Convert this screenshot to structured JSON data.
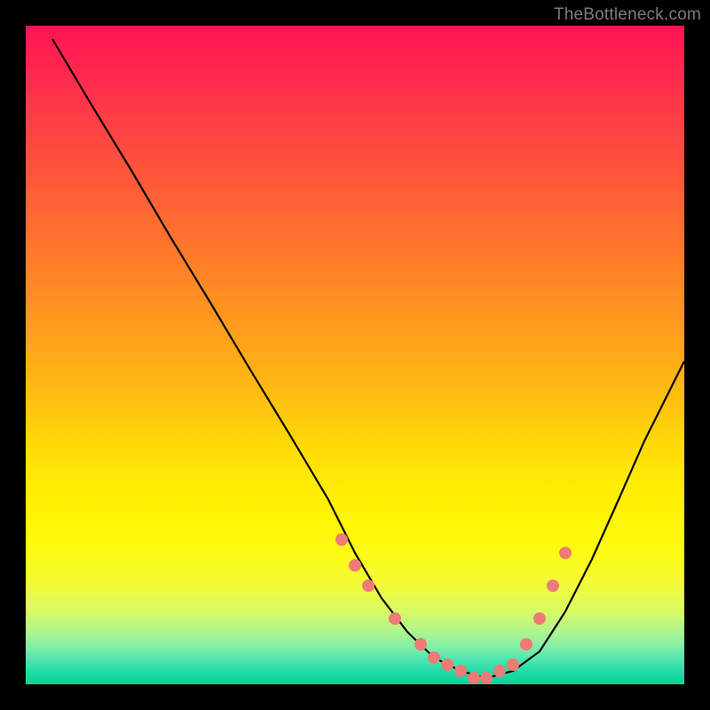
{
  "watermark": "TheBottleneck.com",
  "chart_data": {
    "type": "line",
    "title": "",
    "xlabel": "",
    "ylabel": "",
    "xlim": [
      0,
      100
    ],
    "ylim": [
      0,
      100
    ],
    "note": "Bottleneck curve with gradient background (red = high bottleneck, green = low). No axis ticks or numeric labels are visible in the image; x/y values below are pixel-space estimates on a 0–100 normalized scale.",
    "series": [
      {
        "name": "bottleneck-curve",
        "x": [
          4,
          10,
          16,
          22,
          28,
          34,
          40,
          46,
          50,
          54,
          58,
          62,
          66,
          70,
          74,
          78,
          82,
          86,
          90,
          94,
          98,
          100
        ],
        "y": [
          98,
          88,
          78,
          68,
          58,
          48,
          38,
          28,
          20,
          13,
          8,
          4,
          2,
          1,
          2,
          5,
          11,
          19,
          28,
          37,
          45,
          49
        ]
      }
    ],
    "markers": {
      "name": "highlight-dots",
      "color": "#ef7b76",
      "approximate_radius_px": 6,
      "note": "Salmon dots clustered around the valley on both branches, roughly y in [1,22].",
      "x": [
        48,
        50,
        52,
        56,
        60,
        62,
        64,
        66,
        68,
        70,
        72,
        74,
        76,
        78,
        80,
        82
      ],
      "y": [
        22,
        18,
        15,
        10,
        6,
        4,
        3,
        2,
        1,
        1,
        2,
        3,
        6,
        10,
        15,
        20
      ]
    },
    "background_gradient_stops": [
      {
        "pos": 0.0,
        "color": "#ff1453"
      },
      {
        "pos": 0.5,
        "color": "#ffa31a"
      },
      {
        "pos": 0.8,
        "color": "#fdfb12"
      },
      {
        "pos": 1.0,
        "color": "#05d598"
      }
    ]
  }
}
